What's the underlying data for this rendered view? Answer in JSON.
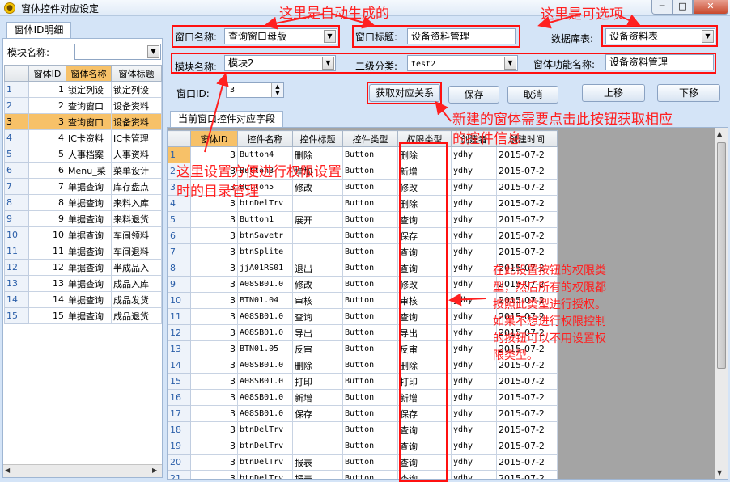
{
  "window": {
    "title": "窗体控件对应设定",
    "min": "─",
    "max": "□",
    "close": "✕"
  },
  "left": {
    "tab": "窗体ID明细",
    "module_label": "模块名称:",
    "module_value": "",
    "columns": [
      "窗体ID",
      "窗体名称",
      "窗体标题"
    ],
    "rows": [
      [
        "1",
        "1",
        "锁定列设",
        "锁定列设"
      ],
      [
        "2",
        "2",
        "查询窗口",
        "设备资料"
      ],
      [
        "3",
        "3",
        "查询窗口",
        "设备资料"
      ],
      [
        "4",
        "4",
        "IC卡资料",
        "IC卡管理"
      ],
      [
        "5",
        "5",
        "人事档案",
        "人事资料"
      ],
      [
        "6",
        "6",
        "Menu_菜",
        "菜单设计"
      ],
      [
        "7",
        "7",
        "单据查询",
        "库存盘点"
      ],
      [
        "8",
        "8",
        "单据查询",
        "来料入库"
      ],
      [
        "9",
        "9",
        "单据查询",
        "来料退货"
      ],
      [
        "10",
        "10",
        "单据查询",
        "车间领料"
      ],
      [
        "11",
        "11",
        "单据查询",
        "车间退料"
      ],
      [
        "12",
        "12",
        "单据查询",
        "半成品入"
      ],
      [
        "13",
        "13",
        "单据查询",
        "成品入库"
      ],
      [
        "14",
        "14",
        "单据查询",
        "成品发货"
      ],
      [
        "15",
        "15",
        "单据查询",
        "成品退货"
      ]
    ]
  },
  "form": {
    "window_name_label": "窗口名称:",
    "window_name_value": "查询窗口母版",
    "window_title_label": "窗口标题:",
    "window_title_value": "设备资料管理",
    "db_table_label": "数据库表:",
    "db_table_value": "设备资料表",
    "module_label": "模块名称:",
    "module_value": "模块2",
    "sub_category_label": "二级分类:",
    "sub_category_value": "test2",
    "func_name_label": "窗体功能名称:",
    "func_name_value": "设备资料管理",
    "window_id_label": "窗口ID:",
    "window_id_value": "3",
    "spin_up": "▲",
    "spin_down": "▼"
  },
  "buttons": {
    "fetch": "获取对应关系",
    "save": "保存",
    "cancel": "取消",
    "up": "上移",
    "down": "下移"
  },
  "grid": {
    "tab": "当前窗口控件对应字段",
    "columns": [
      "窗体ID",
      "控件名称",
      "控件标题",
      "控件类型",
      "权限类型",
      "创建者",
      "创建时间"
    ],
    "rows": [
      [
        "1",
        "3",
        "Button4",
        "删除",
        "Button",
        "删除",
        "ydhy",
        "2015-07-2"
      ],
      [
        "2",
        "3",
        "Button3",
        "增加",
        "Button",
        "新增",
        "ydhy",
        "2015-07-2"
      ],
      [
        "3",
        "3",
        "Button5",
        "修改",
        "Button",
        "修改",
        "ydhy",
        "2015-07-2"
      ],
      [
        "4",
        "3",
        "btnDelTrv",
        "",
        "Button",
        "删除",
        "ydhy",
        "2015-07-2"
      ],
      [
        "5",
        "3",
        "Button1",
        "展开",
        "Button",
        "查询",
        "ydhy",
        "2015-07-2"
      ],
      [
        "6",
        "3",
        "btnSavetr",
        "",
        "Button",
        "保存",
        "ydhy",
        "2015-07-2"
      ],
      [
        "7",
        "3",
        "btnSplite",
        "",
        "Button",
        "查询",
        "ydhy",
        "2015-07-2"
      ],
      [
        "8",
        "3",
        "jjA01RS01",
        "退出",
        "Button",
        "查询",
        "ydhy",
        "2015-07-2"
      ],
      [
        "9",
        "3",
        "A08SB01.0",
        "修改",
        "Button",
        "修改",
        "ydhy",
        "2015-07-2"
      ],
      [
        "10",
        "3",
        "BTN01.04",
        "审核",
        "Button",
        "审核",
        "ydhy",
        "2015-07-2"
      ],
      [
        "11",
        "3",
        "A08SB01.0",
        "查询",
        "Button",
        "查询",
        "ydhy",
        "2015-07-2"
      ],
      [
        "12",
        "3",
        "A08SB01.0",
        "导出",
        "Button",
        "导出",
        "ydhy",
        "2015-07-2"
      ],
      [
        "13",
        "3",
        "BTN01.05",
        "反审",
        "Button",
        "反审",
        "ydhy",
        "2015-07-2"
      ],
      [
        "14",
        "3",
        "A08SB01.0",
        "删除",
        "Button",
        "删除",
        "ydhy",
        "2015-07-2"
      ],
      [
        "15",
        "3",
        "A08SB01.0",
        "打印",
        "Button",
        "打印",
        "ydhy",
        "2015-07-2"
      ],
      [
        "16",
        "3",
        "A08SB01.0",
        "新增",
        "Button",
        "新增",
        "ydhy",
        "2015-07-2"
      ],
      [
        "17",
        "3",
        "A08SB01.0",
        "保存",
        "Button",
        "保存",
        "ydhy",
        "2015-07-2"
      ],
      [
        "18",
        "3",
        "btnDelTrv",
        "",
        "Button",
        "查询",
        "ydhy",
        "2015-07-2"
      ],
      [
        "19",
        "3",
        "btnDelTrv",
        "",
        "Button",
        "查询",
        "ydhy",
        "2015-07-2"
      ],
      [
        "20",
        "3",
        "btnDelTrv",
        "报表",
        "Button",
        "查询",
        "ydhy",
        "2015-07-2"
      ],
      [
        "21",
        "3",
        "btnDelTrv",
        "报表",
        "Button",
        "查询",
        "ydhy",
        "2015-07-2"
      ]
    ]
  },
  "annotations": {
    "auto": "这里是自动生成的",
    "optional": "这里是可选项",
    "new_window": "新建的窗体需要点击此按钮获取相应",
    "new_window_2": "的控件信息",
    "dir_1": "这里设置方便进行权限设置",
    "dir_2": "时的目录管理",
    "perm_text": "在此设置按钮的权限类型，然后所有的权限都按照此类型进行授权。如果不想进行权限控制的按钮可以不用设置权限类型。",
    "color": "#ff2020"
  }
}
